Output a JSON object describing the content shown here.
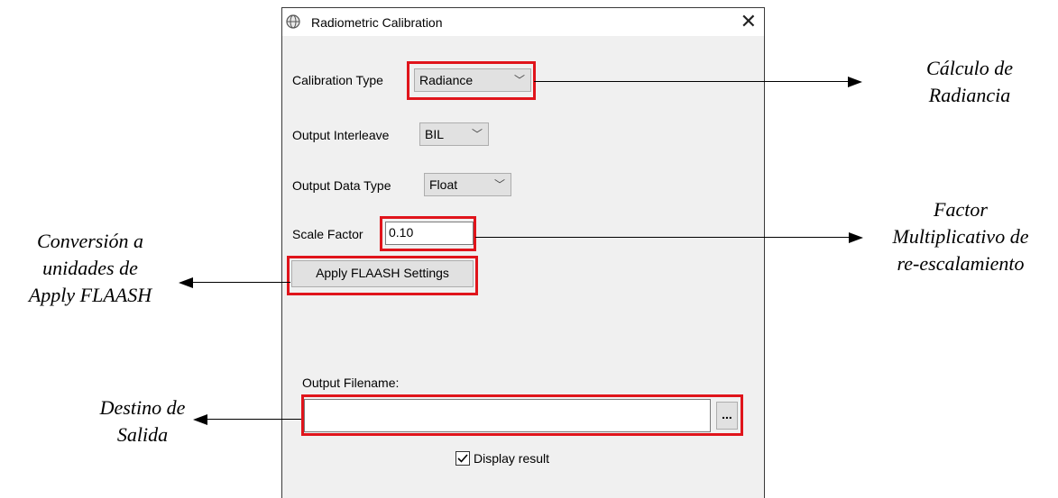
{
  "dialog": {
    "title": "Radiometric Calibration",
    "close_label": "✕",
    "calibration_type": {
      "label": "Calibration Type",
      "value": "Radiance"
    },
    "output_interleave": {
      "label": "Output Interleave",
      "value": "BIL"
    },
    "output_data_type": {
      "label": "Output Data Type",
      "value": "Float"
    },
    "scale_factor": {
      "label": "Scale Factor",
      "value": "0.10"
    },
    "apply_flaash_button": "Apply FLAASH Settings",
    "output_filename": {
      "label": "Output Filename:",
      "value": "",
      "browse_label": "..."
    },
    "display_result": {
      "label": "Display result",
      "checked": true
    }
  },
  "annotations": {
    "radiance": [
      "Cálculo de",
      "Radiancia"
    ],
    "factor": [
      "Factor",
      "Multiplicativo de",
      "re-escalamiento"
    ],
    "conversion": [
      "Conversión a",
      "unidades de",
      "Apply FLAASH"
    ],
    "destino": [
      "Destino de",
      "Salida"
    ]
  },
  "colors": {
    "highlight": "#e0141b",
    "dialog_bg": "#f0f0f0"
  }
}
